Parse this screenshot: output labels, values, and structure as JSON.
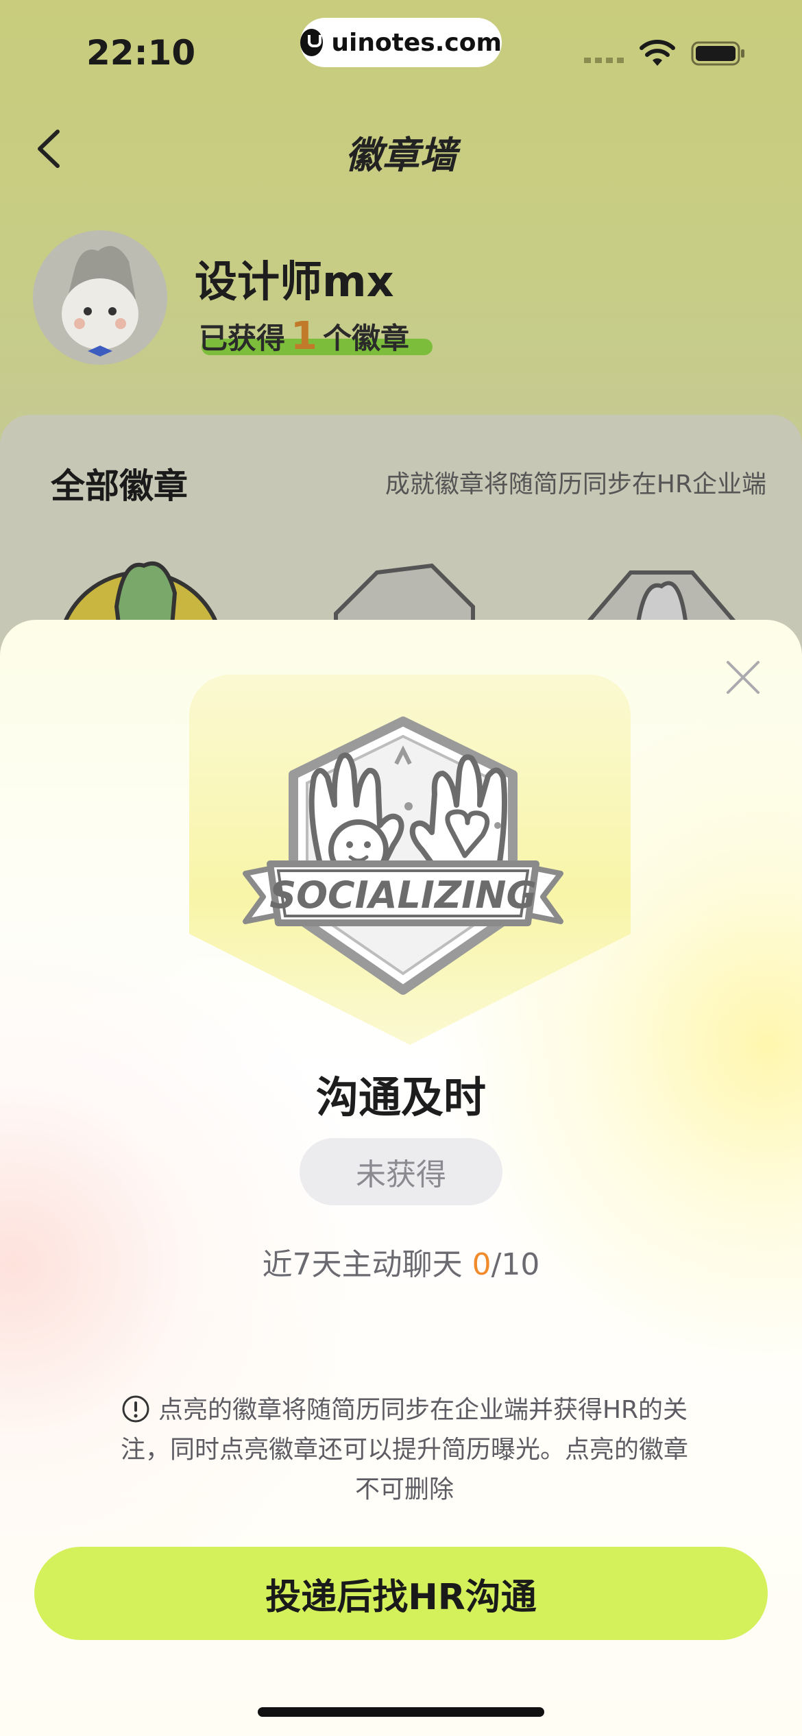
{
  "status_bar": {
    "time": "22:10",
    "url": "uinotes.com"
  },
  "nav": {
    "title": "徽章墙",
    "back_icon": "chevron-left-icon"
  },
  "profile": {
    "username": "设计师mx",
    "earned_prefix": "已获得",
    "earned_count": "1",
    "earned_suffix": "个徽章"
  },
  "badge_wall": {
    "title": "全部徽章",
    "note": "成就徽章将随简历同步在HR企业端"
  },
  "modal": {
    "badge_ribbon_text": "SOCIALIZING",
    "badge_name": "沟通及时",
    "status": "未获得",
    "progress_label": "近7天主动聊天 ",
    "progress_current": "0",
    "progress_total": "/10",
    "info_text": "点亮的徽章将随简历同步在企业端并获得HR的关注，同时点亮徽章还可以提升简历曝光。点亮的徽章不可删除",
    "cta_label": "投递后找HR沟通"
  },
  "colors": {
    "accent": "#d4f15c",
    "progress_highlight": "#f08a2a",
    "overlay": "#c9cf8a"
  }
}
